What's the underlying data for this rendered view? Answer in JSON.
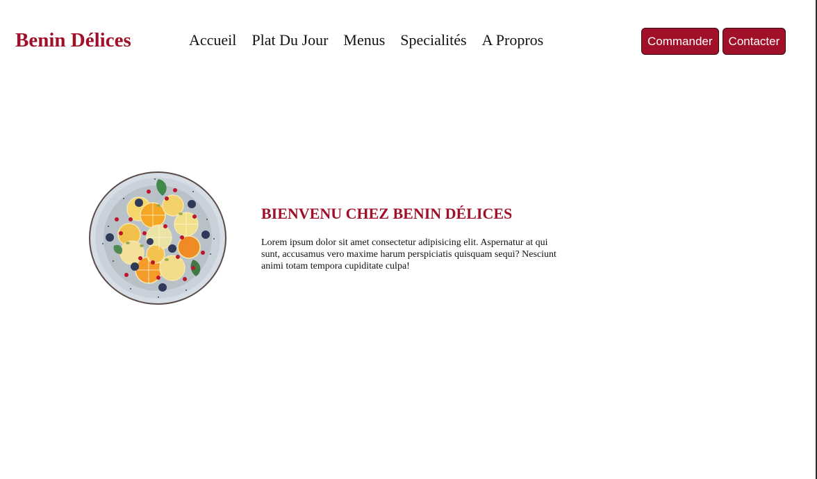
{
  "brand": {
    "name": "Benin Délices",
    "color": "#a01028"
  },
  "nav": {
    "items": [
      {
        "label": "Accueil"
      },
      {
        "label": "Plat Du Jour"
      },
      {
        "label": "Menus"
      },
      {
        "label": "Specialités"
      },
      {
        "label": "A Propros"
      }
    ]
  },
  "actions": {
    "order_label": "Commander",
    "contact_label": "Contacter"
  },
  "hero": {
    "image_icon": "fruit-salad-plate-icon",
    "title": "BIENVENU CHEZ BENIN DÉLICES",
    "body": "Lorem ipsum dolor sit amet consectetur adipisicing elit. Aspernatur at qui sunt, accusamus vero maxime harum perspiciatis quisquam sequi? Nesciunt animi totam tempora cupiditate culpa!"
  }
}
